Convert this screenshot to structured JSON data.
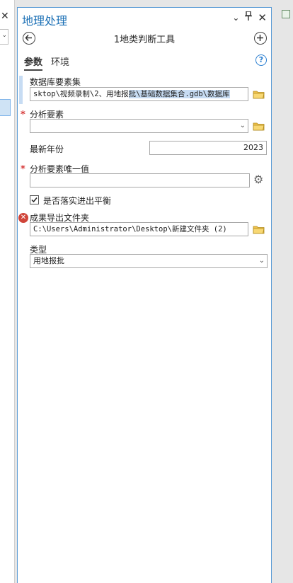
{
  "pane": {
    "title": "地理处理",
    "tool_name": "1地类判断工具"
  },
  "tabs": [
    {
      "label": "参数",
      "active": true
    },
    {
      "label": "环境",
      "active": false
    }
  ],
  "params": {
    "db_feature_set": {
      "label": "数据库要素集",
      "value_pre": "sktop\\视频录制\\2、用地报",
      "value_sel": "批\\基础数据集合.gdb\\数据库"
    },
    "analysis_feature": {
      "label": "分析要素",
      "value": ""
    },
    "latest_year": {
      "label": "最新年份",
      "value": "2023"
    },
    "unique_value": {
      "label": "分析要素唯一值",
      "value": ""
    },
    "balance_check": {
      "label": "是否落实进出平衡",
      "checked": true
    },
    "output_folder": {
      "label": "成果导出文件夹",
      "value": "C:\\Users\\Administrator\\Desktop\\新建文件夹 (2)"
    },
    "type": {
      "label": "类型",
      "value": "用地报批"
    }
  },
  "colors": {
    "accent": "#1a6fb5",
    "required": "#d63a3a",
    "error": "#d0453a",
    "selection": "#c7dcf3"
  }
}
